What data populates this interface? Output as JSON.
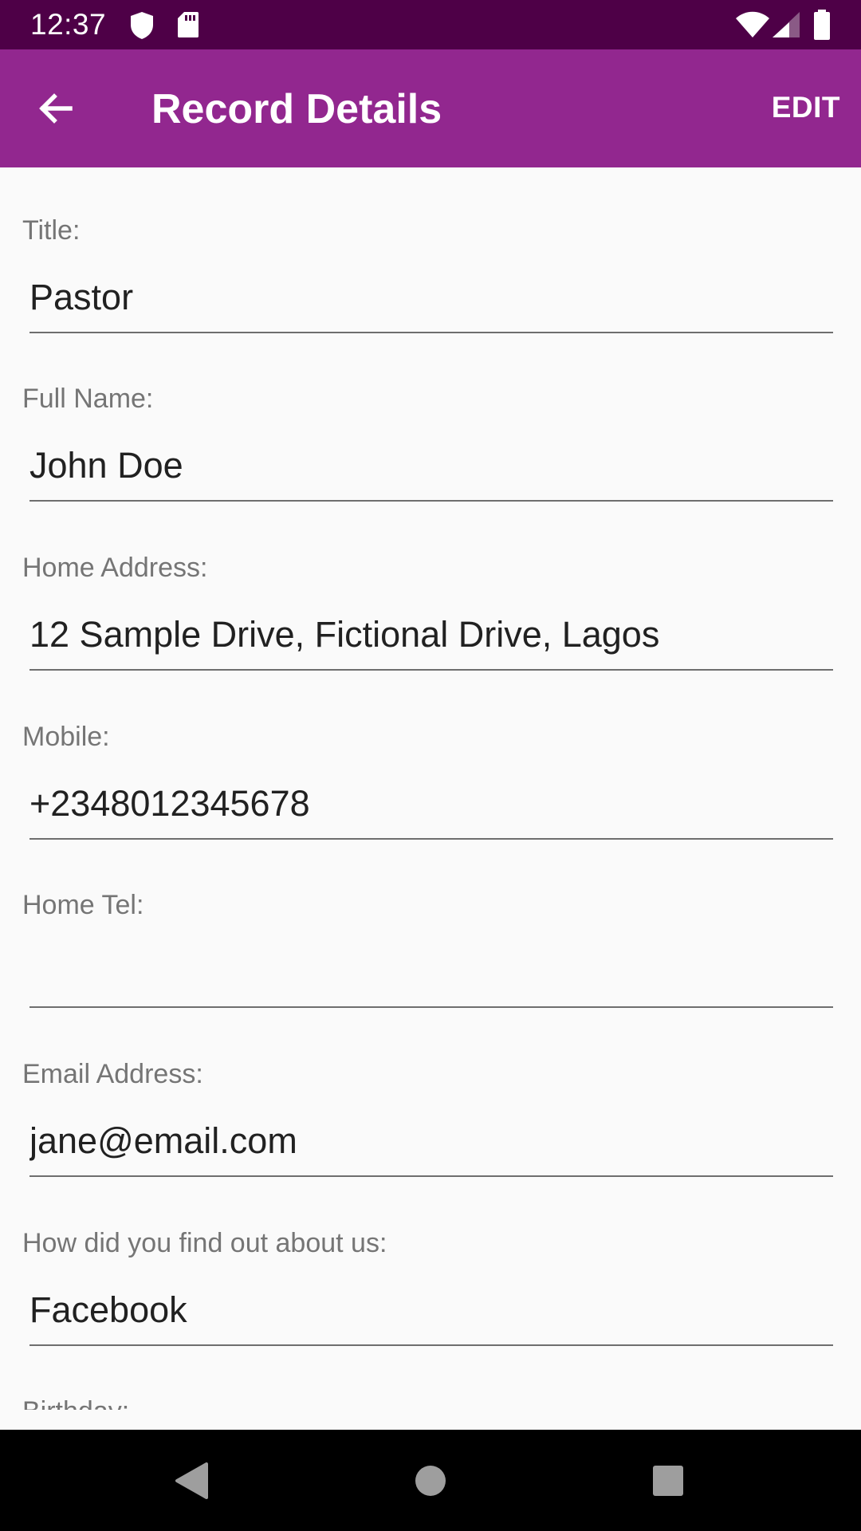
{
  "status_bar": {
    "time": "12:37",
    "icons": [
      "shield-icon",
      "sd-card-icon",
      "wifi-icon",
      "cell-signal-icon",
      "battery-icon"
    ]
  },
  "app_bar": {
    "back_icon": "arrow-back-icon",
    "title": "Record Details",
    "edit_label": "EDIT"
  },
  "fields": [
    {
      "label": "Title:",
      "value": "Pastor"
    },
    {
      "label": "Full Name:",
      "value": "John Doe"
    },
    {
      "label": "Home Address:",
      "value": "12 Sample Drive, Fictional Drive, Lagos"
    },
    {
      "label": "Mobile:",
      "value": "+2348012345678"
    },
    {
      "label": "Home Tel:",
      "value": ""
    },
    {
      "label": "Email Address:",
      "value": "jane@email.com"
    },
    {
      "label": "How did you find out about us:",
      "value": "Facebook"
    },
    {
      "label": "Birthday:",
      "value": ""
    }
  ],
  "nav_bar": {
    "buttons": [
      "back-triangle-icon",
      "home-circle-icon",
      "recents-square-icon"
    ]
  },
  "colors": {
    "status_bar": "#4e0047",
    "app_bar": "#92278f",
    "background": "#fafafa",
    "label_text": "#757575",
    "value_text": "#212121",
    "underline": "#6e6e6e"
  }
}
